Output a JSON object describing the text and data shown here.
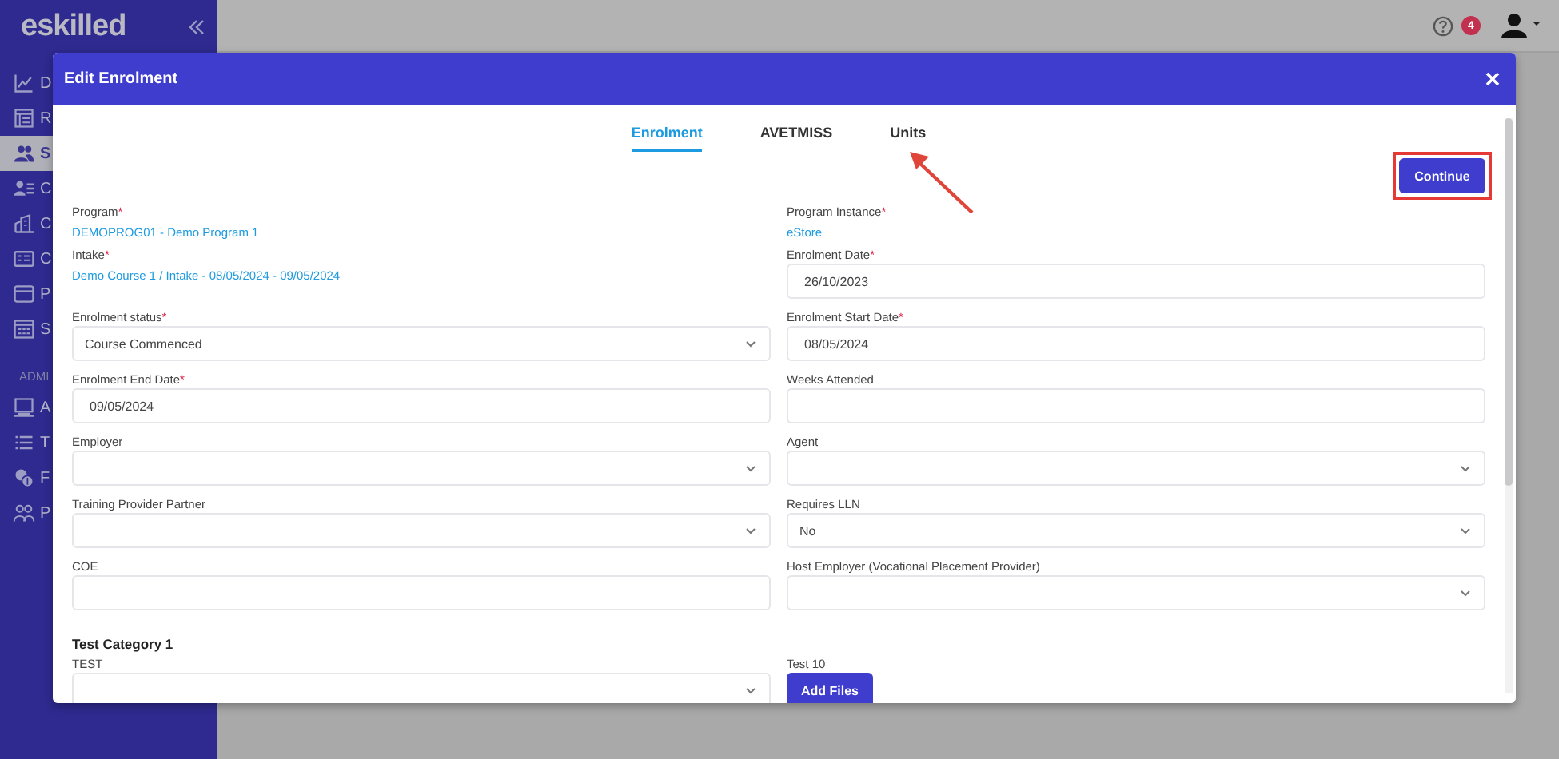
{
  "sidebar": {
    "logo": "eskilled",
    "items": [
      {
        "label": "D",
        "selected": false
      },
      {
        "label": "R",
        "selected": false
      },
      {
        "label": "S",
        "selected": true
      },
      {
        "label": "C",
        "selected": false
      },
      {
        "label": "C",
        "selected": false
      },
      {
        "label": "C",
        "selected": false
      },
      {
        "label": "P",
        "selected": false
      },
      {
        "label": "S",
        "selected": false
      }
    ],
    "section": "ADMI",
    "admin_items": [
      {
        "label": "A",
        "selected": false
      },
      {
        "label": "T",
        "selected": false
      },
      {
        "label": "F",
        "selected": false
      },
      {
        "label": "P",
        "selected": false
      }
    ]
  },
  "topbar": {
    "notification_count": "4"
  },
  "modal": {
    "title": "Edit Enrolment",
    "tabs": [
      {
        "label": "Enrolment",
        "selected": true
      },
      {
        "label": "AVETMISS",
        "selected": false
      },
      {
        "label": "Units",
        "selected": false
      }
    ],
    "continue_button": "Continue",
    "rows": [
      {
        "left": [
          {
            "kind": "link",
            "label": "Program",
            "mark": "*",
            "value": "DEMOPROG01 - Demo Program 1"
          },
          {
            "kind": "link",
            "label": "Intake",
            "mark": "*",
            "value": "Demo Course 1 / Intake - 08/05/2024 - 09/05/2024"
          }
        ],
        "right": [
          {
            "kind": "link",
            "label": "Program Instance",
            "mark": "*",
            "value": "eStore"
          },
          {
            "kind": "input",
            "label": "Enrolment Date",
            "mark": "*",
            "value": "26/10/2023"
          }
        ]
      },
      {
        "left": [
          {
            "kind": "select",
            "label": "Enrolment status",
            "mark": "*",
            "value": "Course Commenced"
          }
        ],
        "right": [
          {
            "kind": "input",
            "label": "Enrolment Start Date",
            "mark": "*",
            "value": "08/05/2024"
          }
        ]
      },
      {
        "left": [
          {
            "kind": "input",
            "label": "Enrolment End Date",
            "mark": "*",
            "value": "09/05/2024"
          }
        ],
        "right": [
          {
            "kind": "input",
            "label": "Weeks Attended"
          }
        ]
      },
      {
        "left": [
          {
            "kind": "select",
            "label": "Employer"
          }
        ],
        "right": [
          {
            "kind": "select",
            "label": "Agent"
          }
        ]
      },
      {
        "left": [
          {
            "kind": "select",
            "label": "Training Provider Partner"
          }
        ],
        "right": [
          {
            "kind": "select",
            "label": "Requires LLN",
            "value": "No"
          }
        ]
      },
      {
        "left": [
          {
            "kind": "input",
            "label": "COE"
          }
        ],
        "right": [
          {
            "kind": "select",
            "label": "Host Employer (Vocational Placement Provider)"
          }
        ]
      },
      {
        "left": [
          {
            "kind": "heading",
            "label": "Test Category 1"
          }
        ]
      },
      {
        "left": [
          {
            "kind": "select",
            "label": "TEST"
          }
        ],
        "right": [
          {
            "kind": "button",
            "label": "Test 10",
            "value": "Add Files"
          }
        ]
      }
    ]
  }
}
